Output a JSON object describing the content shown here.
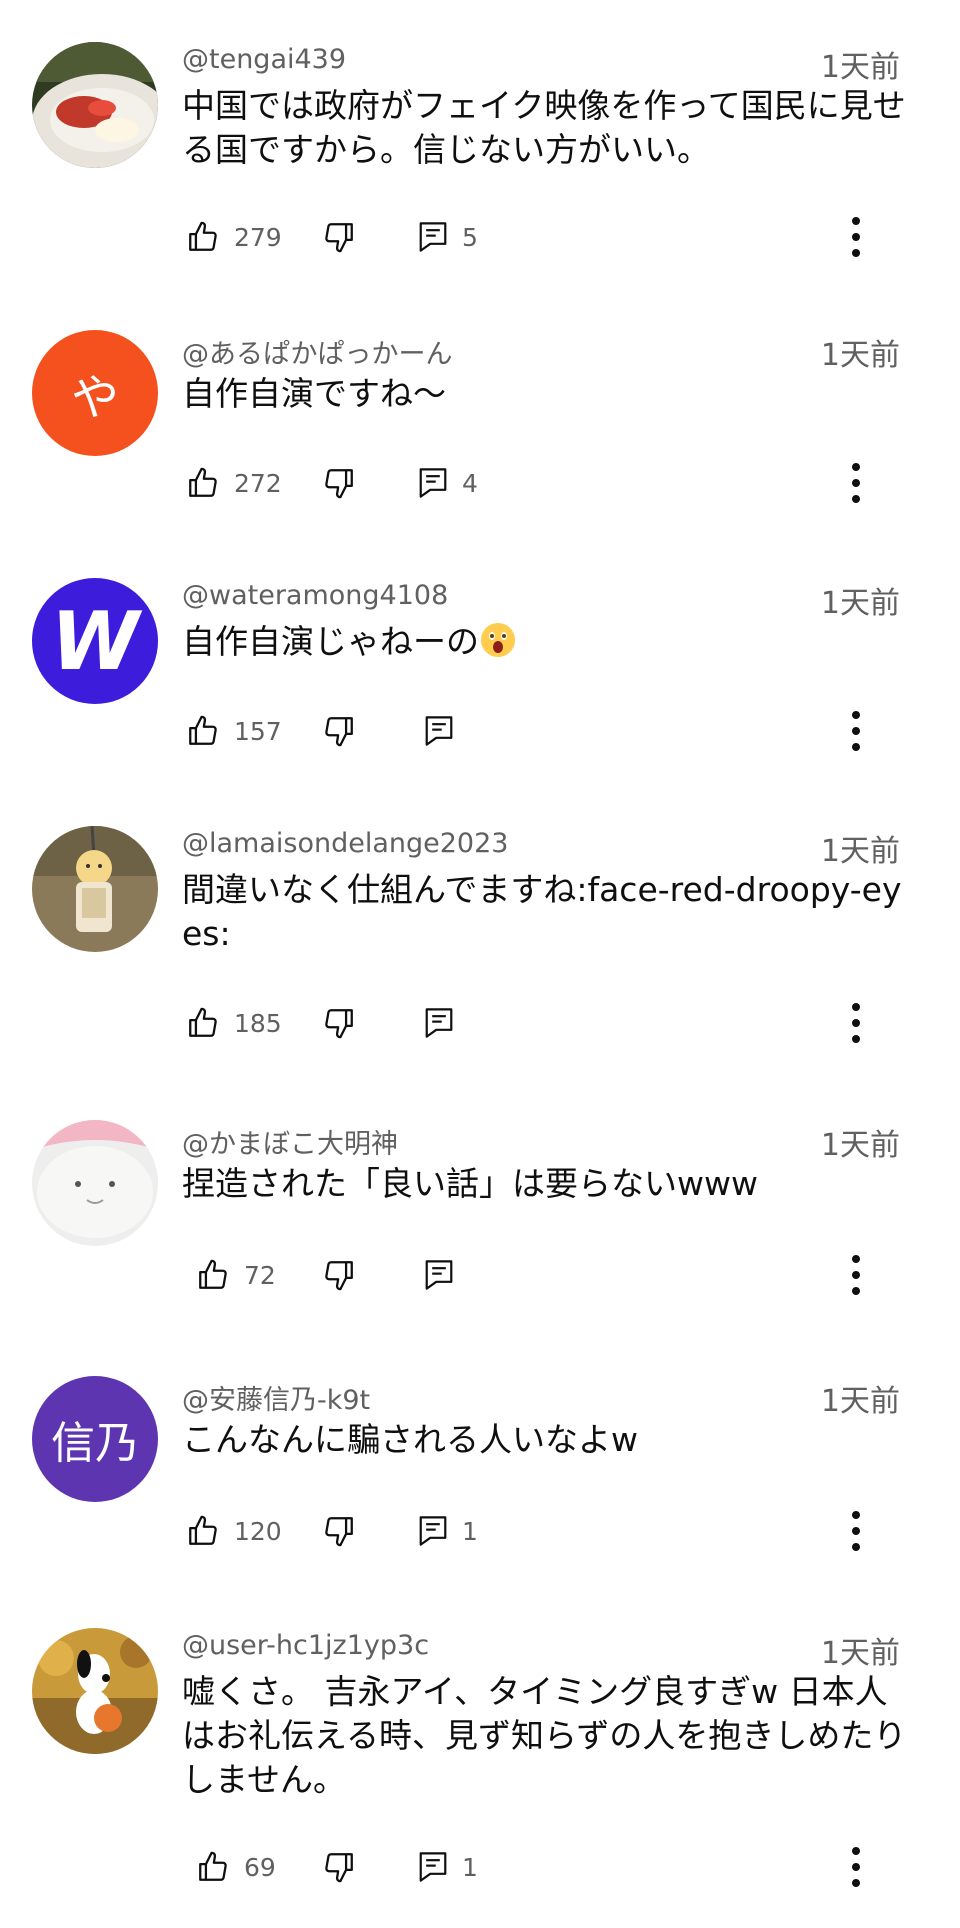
{
  "comments": [
    {
      "author": "@tengai439",
      "time": "1天前",
      "text": "中国では政府がフェイク映像を作って国民に見せる国ですから。信じない方がいい。",
      "likes": "279",
      "replies": "5",
      "avatar": "food-photo"
    },
    {
      "author": "@あるぱかぱっかーん",
      "time": "1天前",
      "text": "自作自演ですね～",
      "likes": "272",
      "replies": "4",
      "avatar": "letter",
      "avatar_letter": "や",
      "avatar_color": "#f4511e"
    },
    {
      "author": "@wateramong4108",
      "time": "1天前",
      "text": "自作自演じゃねーの",
      "likes": "157",
      "replies": "",
      "avatar": "letter",
      "avatar_letter": "W",
      "avatar_color": "#3d1cdb",
      "emoji": "surprised-face"
    },
    {
      "author": "@lamaisondelange2023",
      "time": "1天前",
      "text": "間違いなく仕組んでますね:face-red-droopy-eyes:",
      "likes": "185",
      "replies": "",
      "avatar": "keychain-photo"
    },
    {
      "author": "@かまぼこ大明神",
      "time": "1天前",
      "text": "捏造された「良い話」は要らないwww",
      "likes": "72",
      "replies": "",
      "avatar": "white-creature-photo"
    },
    {
      "author": "@安藤信乃-k9t",
      "time": "1天前",
      "text": "こんなんに騙される人いなよw",
      "likes": "120",
      "replies": "1",
      "avatar": "letter",
      "avatar_letter": "信乃",
      "avatar_color": "#5e35b1"
    },
    {
      "author": "@user-hc1jz1yp3c",
      "time": "1天前",
      "text": "嘘くさ。 吉永アイ、タイミング良すぎw 日本人はお礼伝える時、見ず知らずの人を抱きしめたりしません。",
      "likes": "69",
      "replies": "1",
      "avatar": "snoopy-photo"
    }
  ],
  "icons": {
    "like": "thumb-up-icon",
    "dislike": "thumb-down-icon",
    "reply": "comment-icon",
    "menu": "more-vertical-icon"
  }
}
